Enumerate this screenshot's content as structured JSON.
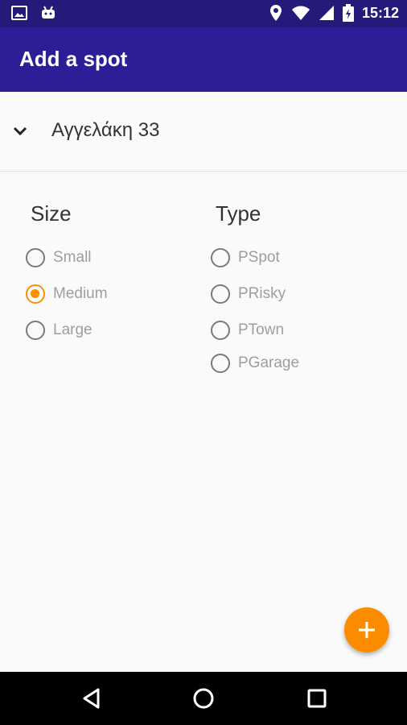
{
  "status_bar": {
    "time": "15:12",
    "left_icons": [
      "image-icon",
      "android-icon"
    ],
    "right_icons": [
      "location-icon",
      "wifi-icon",
      "signal-icon",
      "battery-icon"
    ]
  },
  "app_bar": {
    "title": "Add a spot"
  },
  "address": {
    "text": "Αγγελάκη 33",
    "expand_icon": "chevron-down-icon"
  },
  "size": {
    "title": "Size",
    "options": [
      {
        "label": "Small",
        "checked": false
      },
      {
        "label": "Medium",
        "checked": true
      },
      {
        "label": "Large",
        "checked": false
      }
    ]
  },
  "type": {
    "title": "Type",
    "options": [
      {
        "label": "PSpot",
        "checked": false
      },
      {
        "label": "PRisky",
        "checked": false
      },
      {
        "label": "PTown",
        "checked": false
      },
      {
        "label": "PGarage",
        "checked": false
      }
    ]
  },
  "fab": {
    "icon": "plus-icon"
  },
  "colors": {
    "primary": "#2c1e96",
    "primary_dark": "#241a7a",
    "accent": "#fb8c00"
  },
  "nav_bar": {
    "buttons": [
      "back-icon",
      "home-icon",
      "recents-icon"
    ]
  }
}
